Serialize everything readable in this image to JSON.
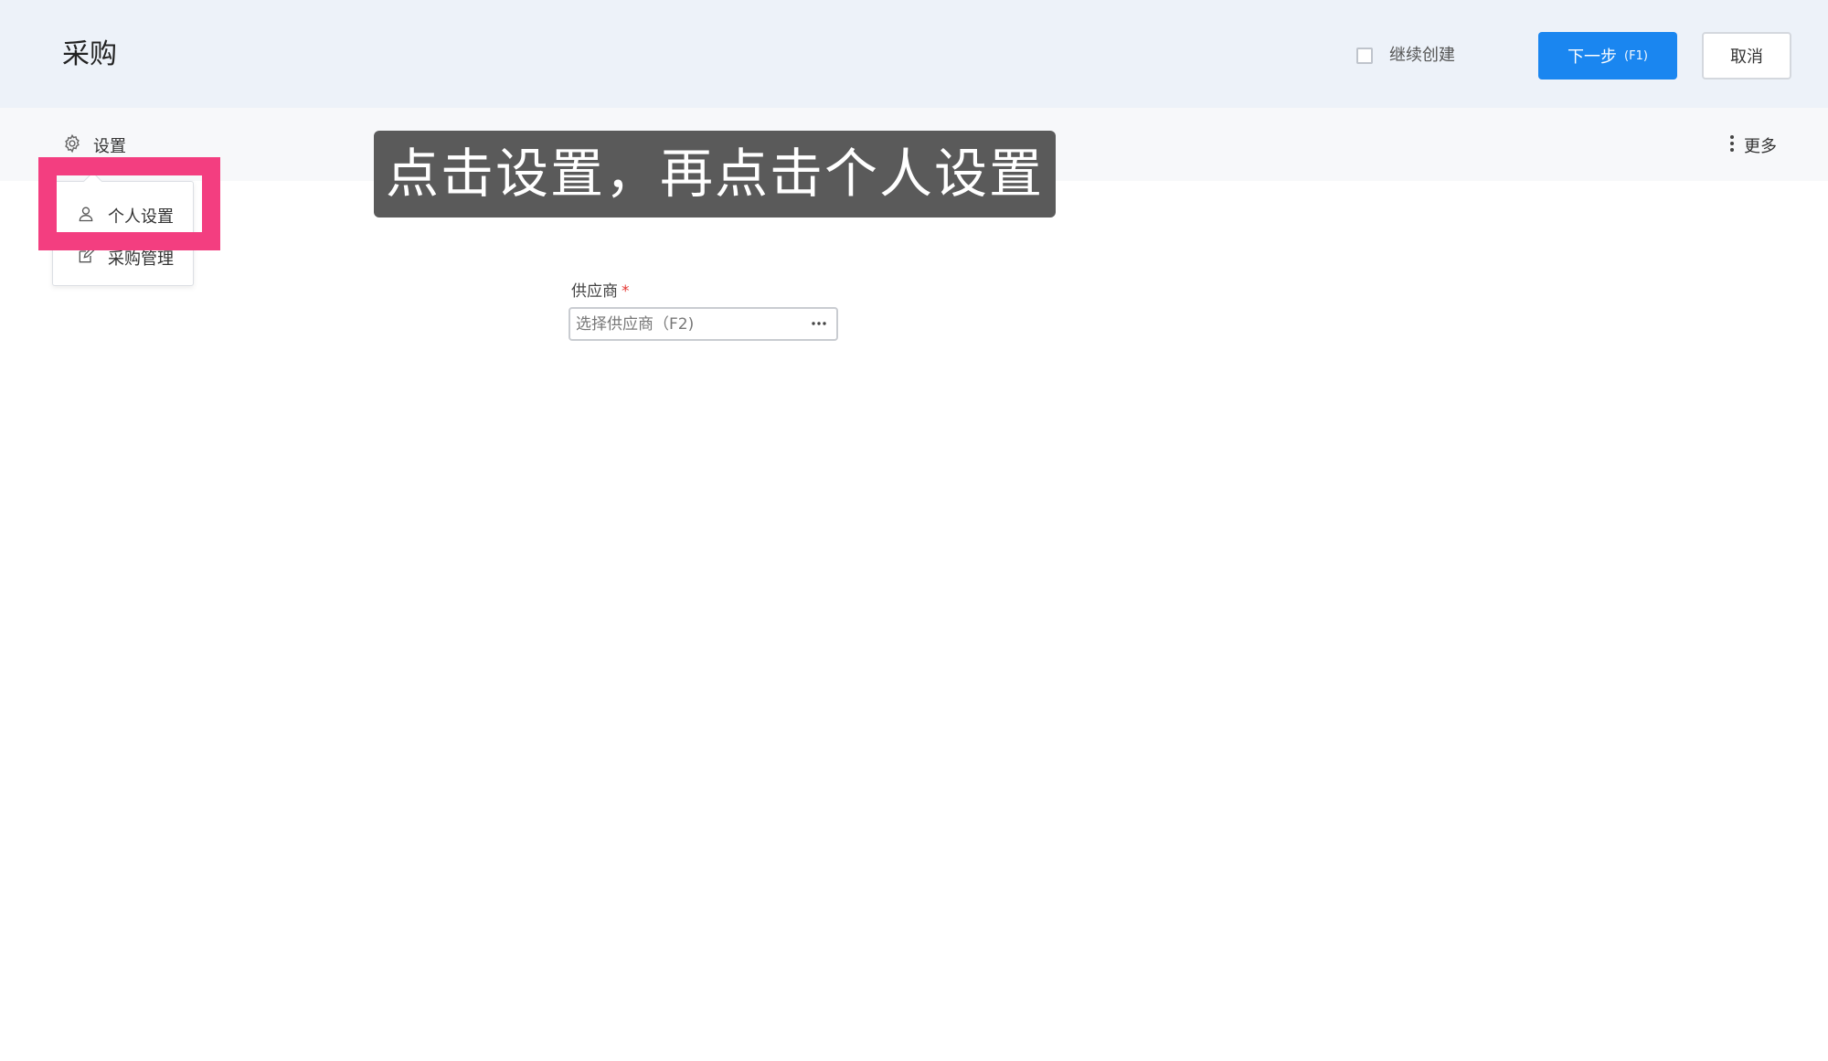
{
  "header": {
    "title": "采购",
    "continue_create_label": "继续创建",
    "next_label": "下一步",
    "next_hint": "(F1)",
    "cancel_label": "取消"
  },
  "toolbar": {
    "settings_label": "设置",
    "more_label": "更多"
  },
  "settings_menu": {
    "items": [
      {
        "label": "个人设置",
        "icon": "user-icon"
      },
      {
        "label": "采购管理",
        "icon": "edit-icon"
      }
    ]
  },
  "instruction": {
    "text": "点击设置，再点击个人设置"
  },
  "form": {
    "supplier_label": "供应商",
    "required_mark": "*",
    "supplier_placeholder": "选择供应商（F2)",
    "supplier_value": ""
  },
  "colors": {
    "primary": "#1a86f0",
    "highlight": "#f33e80",
    "header_bg": "#edf2f9",
    "toolbar_bg": "#f7f8fa",
    "required": "#e53935"
  }
}
